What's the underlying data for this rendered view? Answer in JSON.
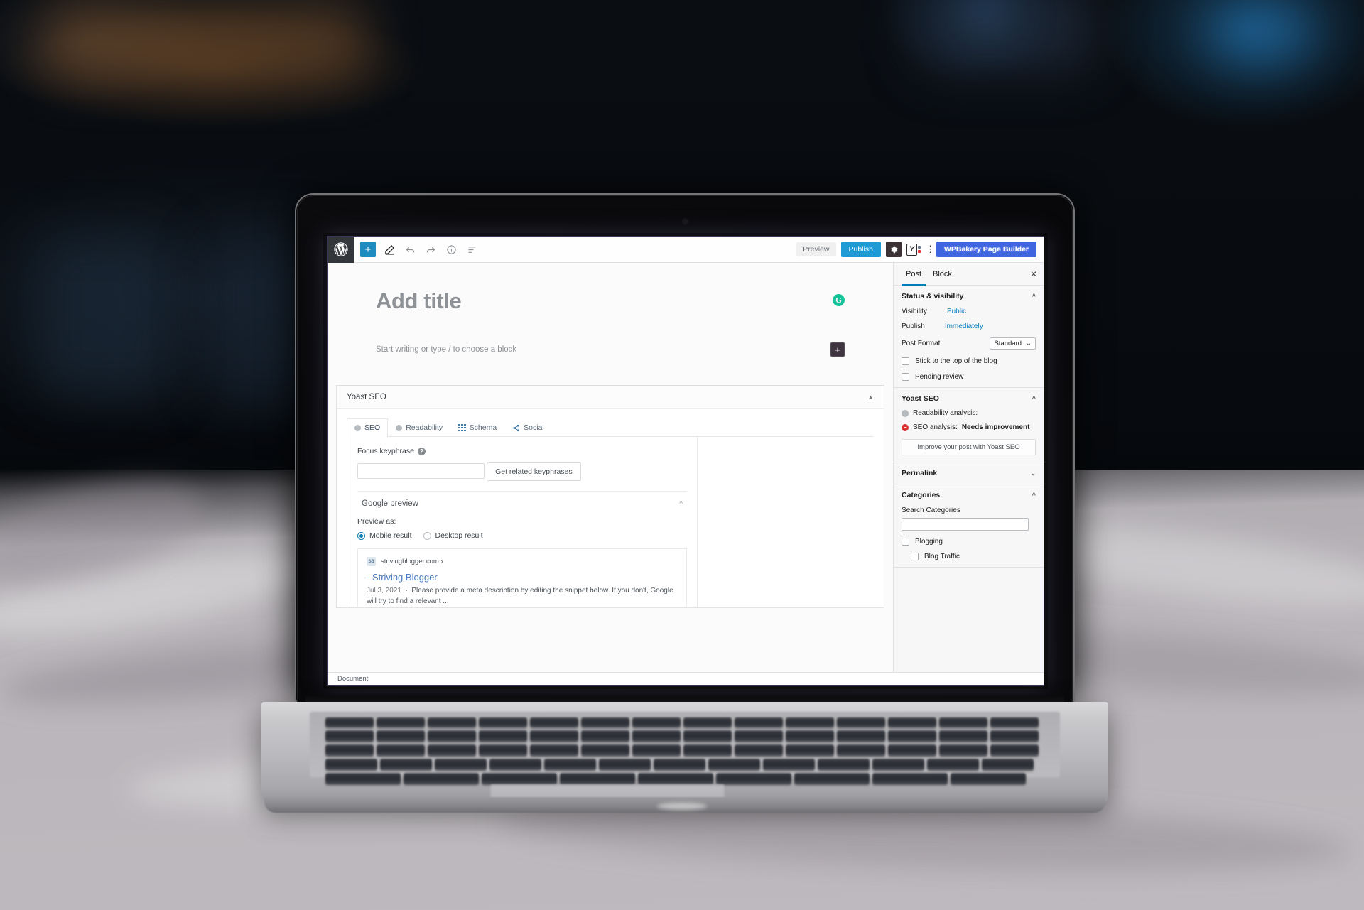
{
  "app": {
    "name": "WordPress Block Editor",
    "logo_icon": "wordpress-logo-icon"
  },
  "toolbar": {
    "add_block_label": "+",
    "icons": [
      "add-block-icon",
      "pencil-tools-icon",
      "undo-icon",
      "redo-icon",
      "info-icon",
      "list-view-icon"
    ],
    "preview_label": "Preview",
    "publish_label": "Publish",
    "settings_icon": "gear-icon",
    "yoast_icon": "yoast-seo-icon",
    "options_icon": "kebab-menu-icon",
    "wpbakery_label": "WPBakery Page Builder",
    "accent_blue": "#1e9bd4",
    "wpbakery_blue": "#3f66e0"
  },
  "editor": {
    "title_placeholder": "Add title",
    "paragraph_placeholder": "Start writing or type / to choose a block",
    "grammarly_icon_label": "G",
    "block_inserter_label": "+"
  },
  "yoast_metabox": {
    "title": "Yoast SEO",
    "collapse_icon": "chevron-up-icon",
    "tabs": [
      {
        "label": "SEO",
        "icon": "seo-bullet-icon",
        "active": true
      },
      {
        "label": "Readability",
        "icon": "readability-bullet-icon",
        "active": false
      },
      {
        "label": "Schema",
        "icon": "schema-grid-icon",
        "active": false
      },
      {
        "label": "Social",
        "icon": "share-icon",
        "active": false
      }
    ],
    "focus_keyphrase": {
      "label": "Focus keyphrase",
      "help_icon": "help-question-icon",
      "value": "",
      "related_button": "Get related keyphrases"
    },
    "google_preview": {
      "title": "Google preview",
      "collapse_icon": "chevron-up-icon",
      "preview_as_label": "Preview as:",
      "options": [
        {
          "label": "Mobile result",
          "selected": true
        },
        {
          "label": "Desktop result",
          "selected": false
        }
      ],
      "snippet": {
        "favicon_label": "SB",
        "domain": "strivingblogger.com ›",
        "title": "- Striving Blogger",
        "date": "Jul 3, 2021",
        "description": "Please provide a meta description by editing the snippet below. If you don't, Google will try to find a relevant ..."
      }
    }
  },
  "sidebar": {
    "tabs": [
      {
        "label": "Post",
        "active": true
      },
      {
        "label": "Block",
        "active": false
      }
    ],
    "close_icon": "close-icon",
    "status_visibility": {
      "title": "Status & visibility",
      "collapse_icon": "chevron-up-icon",
      "visibility_label": "Visibility",
      "visibility_value": "Public",
      "publish_label": "Publish",
      "publish_value": "Immediately",
      "post_format_label": "Post Format",
      "post_format_value": "Standard",
      "post_format_caret": "chevron-down-icon",
      "checkboxes": [
        {
          "label": "Stick to the top of the blog",
          "checked": false
        },
        {
          "label": "Pending review",
          "checked": false
        }
      ]
    },
    "yoast_seo": {
      "title": "Yoast SEO",
      "collapse_icon": "chevron-up-icon",
      "readability_label": "Readability analysis:",
      "readability_value": "",
      "seo_label": "SEO analysis:",
      "seo_value": "Needs improvement",
      "seo_status_color": "#dc3232",
      "improve_button": "Improve your post with Yoast SEO"
    },
    "permalink": {
      "title": "Permalink",
      "collapse_icon": "chevron-down-icon"
    },
    "categories": {
      "title": "Categories",
      "collapse_icon": "chevron-up-icon",
      "search_label": "Search Categories",
      "search_value": "",
      "items": [
        {
          "label": "Blogging",
          "checked": false,
          "indent": false
        },
        {
          "label": "Blog Traffic",
          "checked": false,
          "indent": true
        }
      ]
    }
  },
  "status_bar": {
    "label": "Document"
  }
}
